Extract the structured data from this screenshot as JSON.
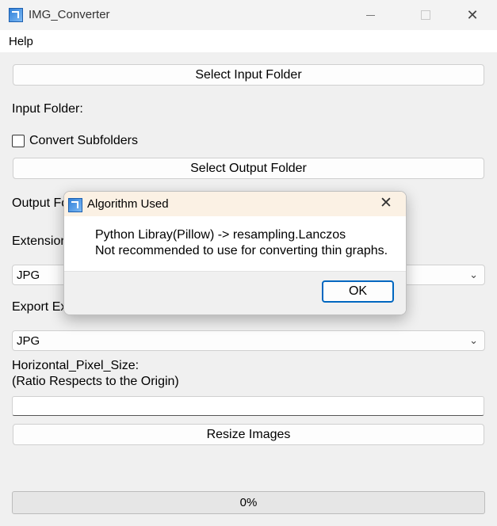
{
  "window": {
    "title": "IMG_Converter",
    "minimize_icon": "minimize-icon",
    "maximize_icon": "maximize-icon",
    "close_glyph": "✕"
  },
  "menu": {
    "help": "Help"
  },
  "main": {
    "select_input_label": "Select Input Folder",
    "input_folder_label": "Input Folder:",
    "convert_subfolders_label": "Convert Subfolders",
    "convert_subfolders_checked": false,
    "select_output_label": "Select Output Folder",
    "output_folder_label": "Output Fo",
    "extension_label": "Extension",
    "extension_value": "JPG",
    "export_extension_label": "Export Ex",
    "export_extension_value": "JPG",
    "pixel_size_label": "Horizontal_Pixel_Size:",
    "pixel_size_hint": "(Ratio Respects to the Origin)",
    "pixel_size_value": "",
    "resize_label": "Resize Images",
    "progress_text": "0%",
    "progress_value": 0
  },
  "dialog": {
    "title": "Algorithm Used",
    "close_glyph": "✕",
    "message_line1": "Python Libray(Pillow) -> resampling.Lanczos",
    "message_line2": "Not recommended to use for converting thin graphs.",
    "ok_label": "OK"
  },
  "colors": {
    "accent": "#0067c0",
    "dialog_title_bg": "#fbf1e4",
    "window_bg": "#f0f0f0"
  }
}
